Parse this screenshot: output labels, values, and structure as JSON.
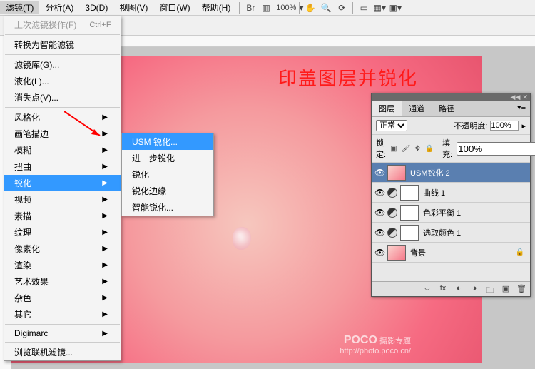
{
  "menubar": {
    "items": [
      "滤镜(T)",
      "分析(A)",
      "3D(D)",
      "视图(V)",
      "窗口(W)",
      "帮助(H)"
    ],
    "zoom": "100%"
  },
  "filter_menu": {
    "last_filter": "上次滤镜操作(F)",
    "last_filter_shortcut": "Ctrl+F",
    "smart": "转换为智能滤镜",
    "gallery": "滤镜库(G)...",
    "liquify": "液化(L)...",
    "vanishing": "消失点(V)...",
    "groups": [
      "风格化",
      "画笔描边",
      "模糊",
      "扭曲",
      "锐化",
      "视频",
      "素描",
      "纹理",
      "像素化",
      "渲染",
      "艺术效果",
      "杂色",
      "其它"
    ],
    "digimarc": "Digimarc",
    "browse": "浏览联机滤镜..."
  },
  "sharpen_submenu": {
    "items": [
      "USM 锐化...",
      "进一步锐化",
      "锐化",
      "锐化边缘",
      "智能锐化..."
    ]
  },
  "canvas": {
    "overlay_text": "印盖图层并锐化",
    "watermark_brand": "POCO",
    "watermark_sub": "摄影专题",
    "watermark_url": "http://photo.poco.cn/"
  },
  "layers_panel": {
    "tabs": [
      "图层",
      "通道",
      "路径"
    ],
    "blend_mode": "正常",
    "opacity_label": "不透明度:",
    "opacity_value": "100%",
    "lock_label": "锁定:",
    "fill_label": "填充:",
    "fill_value": "100%",
    "layers": [
      {
        "name": "USM锐化 2",
        "type": "image",
        "selected": true
      },
      {
        "name": "曲线 1",
        "type": "adjustment"
      },
      {
        "name": "色彩平衡 1",
        "type": "adjustment"
      },
      {
        "name": "选取颜色 1",
        "type": "adjustment"
      },
      {
        "name": "背景",
        "type": "image_bg",
        "locked": true
      }
    ]
  }
}
